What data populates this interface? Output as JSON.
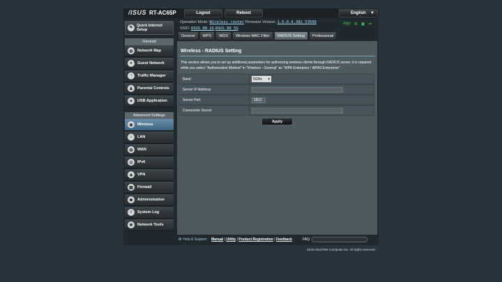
{
  "header": {
    "logo": "/ISUS",
    "model": "RT-AC65P",
    "logout_label": "Logout",
    "reboot_label": "Reboot",
    "language": "English"
  },
  "status": {
    "operation_mode_label": "Operation Mode:",
    "operation_mode_value": "Wireless router",
    "firmware_label": "Firmware Version:",
    "firmware_value": "1.0.0.4.382_53599",
    "ssid_label": "SSID:",
    "ssid_1": "ASUS_88_2G",
    "ssid_2": "ASUS_88_5G",
    "app_label": "App"
  },
  "sidebar": {
    "qis_label_1": "Quick Internet",
    "qis_label_2": "Setup",
    "general_header": "General",
    "general_items": [
      {
        "label": "Network Map"
      },
      {
        "label": "Guest Network"
      },
      {
        "label": "Traffic Manager"
      },
      {
        "label": "Parental Controls"
      },
      {
        "label": "USB Application"
      }
    ],
    "advanced_header": "Advanced Settings",
    "advanced_items": [
      {
        "label": "Wireless"
      },
      {
        "label": "LAN"
      },
      {
        "label": "WAN"
      },
      {
        "label": "IPv6"
      },
      {
        "label": "VPN"
      },
      {
        "label": "Firewall"
      },
      {
        "label": "Administration"
      },
      {
        "label": "System Log"
      },
      {
        "label": "Network Tools"
      }
    ]
  },
  "tabs": [
    {
      "label": "General"
    },
    {
      "label": "WPS"
    },
    {
      "label": "WDS"
    },
    {
      "label": "Wireless MAC Filter"
    },
    {
      "label": "RADIUS Setting"
    },
    {
      "label": "Professional"
    }
  ],
  "main": {
    "title": "Wireless - RADIUS Setting",
    "description": "This section allows you to set up additional parameters for authorizing wireless clients through RADIUS server. It is required while you select \"Authorization Method\" in \"Wireless - General\" as \"WPA-Enterprise / WPA2-Enterprise\".",
    "fields": [
      {
        "label": "Band",
        "value": "5GHz"
      },
      {
        "label": "Server IP Address",
        "value": ""
      },
      {
        "label": "Server Port",
        "value": "1812"
      },
      {
        "label": "Connection Secret",
        "value": ""
      }
    ],
    "apply_label": "Apply"
  },
  "footer": {
    "help_label": "Help & Support",
    "manual": "Manual",
    "utility": "Utility",
    "product_registration": "Product Registration",
    "feedback": "Feedback",
    "faq_label": "FAQ",
    "copyright": "2019 ASUSTeK Computer Inc. All rights reserved."
  }
}
